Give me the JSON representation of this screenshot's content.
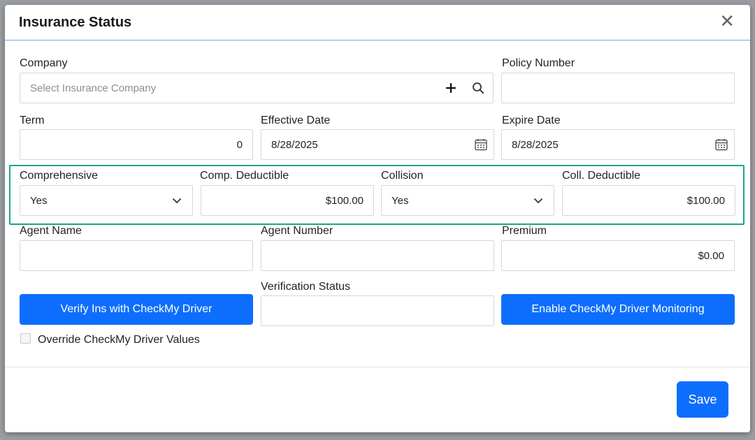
{
  "modal": {
    "title": "Insurance Status",
    "close_glyph": "✕"
  },
  "fields": {
    "company": {
      "label": "Company",
      "placeholder": "Select Insurance Company",
      "add_icon": "plus-icon",
      "search_icon": "search-icon"
    },
    "policy_number": {
      "label": "Policy Number",
      "value": ""
    },
    "term": {
      "label": "Term",
      "value": "0"
    },
    "effective_date": {
      "label": "Effective Date",
      "value": "8/28/2025",
      "icon": "calendar-icon"
    },
    "expire_date": {
      "label": "Expire Date",
      "value": "8/28/2025",
      "icon": "calendar-icon"
    },
    "comprehensive": {
      "label": "Comprehensive",
      "value": "Yes"
    },
    "comp_deductible": {
      "label": "Comp. Deductible",
      "value": "$100.00"
    },
    "collision": {
      "label": "Collision",
      "value": "Yes"
    },
    "coll_deductible": {
      "label": "Coll. Deductible",
      "value": "$100.00"
    },
    "agent_name": {
      "label": "Agent Name",
      "value": ""
    },
    "agent_number": {
      "label": "Agent Number",
      "value": ""
    },
    "premium": {
      "label": "Premium",
      "value": "$0.00"
    },
    "verification_status": {
      "label": "Verification Status",
      "value": ""
    }
  },
  "buttons": {
    "verify": "Verify Ins with CheckMy Driver",
    "enable_monitoring": "Enable CheckMy Driver Monitoring",
    "save": "Save"
  },
  "override": {
    "label": "Override CheckMy Driver Values",
    "checked": false
  },
  "colors": {
    "primary": "#0d6efd",
    "group_border": "#1fa38a",
    "header_border": "#7ea7d8"
  }
}
